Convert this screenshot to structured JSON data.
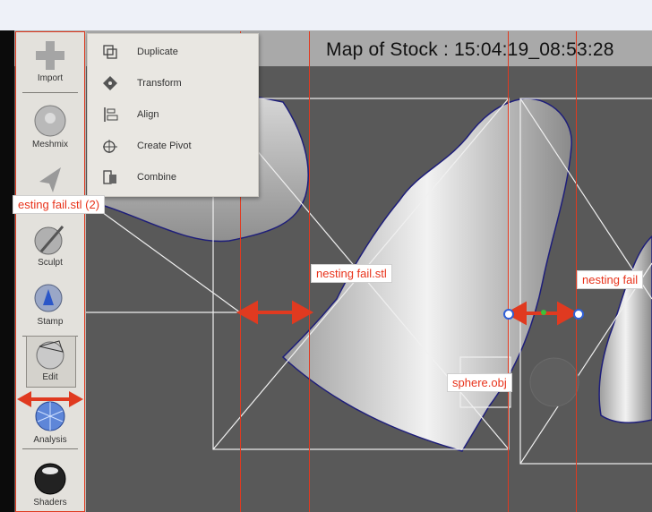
{
  "header": {
    "map_title": "Map of Stock : 15:04:19_08:53:28"
  },
  "toolbar": {
    "items": [
      {
        "label": "Import",
        "icon": "plus-icon"
      },
      {
        "label": "Meshmix",
        "icon": "meshmix-ball-icon"
      },
      {
        "label": "Select",
        "icon": "arrow-cursor-icon"
      },
      {
        "label": "Sculpt",
        "icon": "brush-ball-icon"
      },
      {
        "label": "Stamp",
        "icon": "stamp-icon"
      },
      {
        "label": "Edit",
        "icon": "edit-sphere-icon"
      },
      {
        "label": "Analysis",
        "icon": "mesh-sphere-icon"
      },
      {
        "label": "Shaders",
        "icon": "shader-sphere-icon"
      }
    ],
    "selected": "Edit"
  },
  "edit_menu": {
    "items": [
      {
        "label": "Duplicate",
        "icon": "duplicate-icon"
      },
      {
        "label": "Transform",
        "icon": "transform-icon"
      },
      {
        "label": "Align",
        "icon": "align-icon"
      },
      {
        "label": "Create Pivot",
        "icon": "pivot-icon"
      },
      {
        "label": "Combine",
        "icon": "combine-icon"
      }
    ]
  },
  "objects": {
    "labels": [
      "esting fail.stl (2)",
      "nesting fail.stl",
      "nesting fail",
      "sphere.obj"
    ]
  },
  "colors": {
    "accent_red": "#e03a20",
    "handle_blue": "#2f5fd6",
    "viewport_bg": "#595959"
  }
}
